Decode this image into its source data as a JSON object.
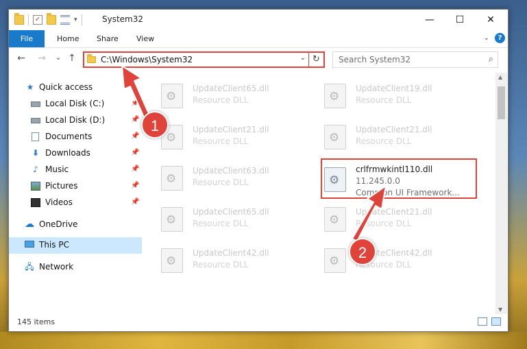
{
  "window": {
    "title": "System32",
    "controls": {
      "minimize": "—",
      "maximize": "☐",
      "close": "✕"
    }
  },
  "ribbon": {
    "tabs": [
      {
        "label": "File",
        "active": true
      },
      {
        "label": "Home"
      },
      {
        "label": "Share"
      },
      {
        "label": "View"
      }
    ],
    "help_label": "?"
  },
  "navigation": {
    "back": "←",
    "forward": "→",
    "recent": "⌄",
    "up": "↑",
    "address": "C:\\Windows\\System32",
    "refresh": "↻",
    "search_placeholder": "Search System32"
  },
  "sidebar": {
    "items": [
      {
        "label": "Quick access",
        "icon": "star-icon"
      },
      {
        "label": "Local Disk (C:)",
        "icon": "drive-icon",
        "pinned": true
      },
      {
        "label": "Local Disk (D:)",
        "icon": "drive-icon",
        "pinned": true
      },
      {
        "label": "Documents",
        "icon": "document-icon",
        "pinned": true
      },
      {
        "label": "Downloads",
        "icon": "download-icon",
        "pinned": true
      },
      {
        "label": "Music",
        "icon": "music-icon",
        "pinned": true
      },
      {
        "label": "Pictures",
        "icon": "pictures-icon",
        "pinned": true
      },
      {
        "label": "Videos",
        "icon": "videos-icon",
        "pinned": true
      },
      {
        "label": "OneDrive",
        "icon": "cloud-icon"
      },
      {
        "label": "This PC",
        "icon": "computer-icon",
        "selected": true
      },
      {
        "label": "Network",
        "icon": "network-icon"
      }
    ]
  },
  "files": [
    {
      "name": "UpdateClient65.dll",
      "type": "Resource DLL"
    },
    {
      "name": "UpdateClient19.dll",
      "type": "Resource DLL"
    },
    {
      "name": "UpdateClient21.dll",
      "type": "Resource DLL"
    },
    {
      "name": "UpdateClient21.dll",
      "type": "Resource DLL"
    },
    {
      "name": "UpdateClient63.dll",
      "type": "Resource DLL"
    },
    {
      "name": "crlfrmwkintl110.dll",
      "version": "11.245.0.0",
      "type": "Common UI Framework...",
      "highlighted": true
    },
    {
      "name": "UpdateClient65.dll",
      "type": "Resource DLL"
    },
    {
      "name": "UpdateClient21.dll",
      "type": "Resource DLL"
    },
    {
      "name": "UpdateClient42.dll",
      "type": "Resource DLL"
    },
    {
      "name": "UpdateClient42.dll",
      "type": "Resource DLL"
    }
  ],
  "status": {
    "item_count": "145 items"
  },
  "annotations": {
    "step1": "1",
    "step2": "2",
    "color": "#e0433a"
  }
}
